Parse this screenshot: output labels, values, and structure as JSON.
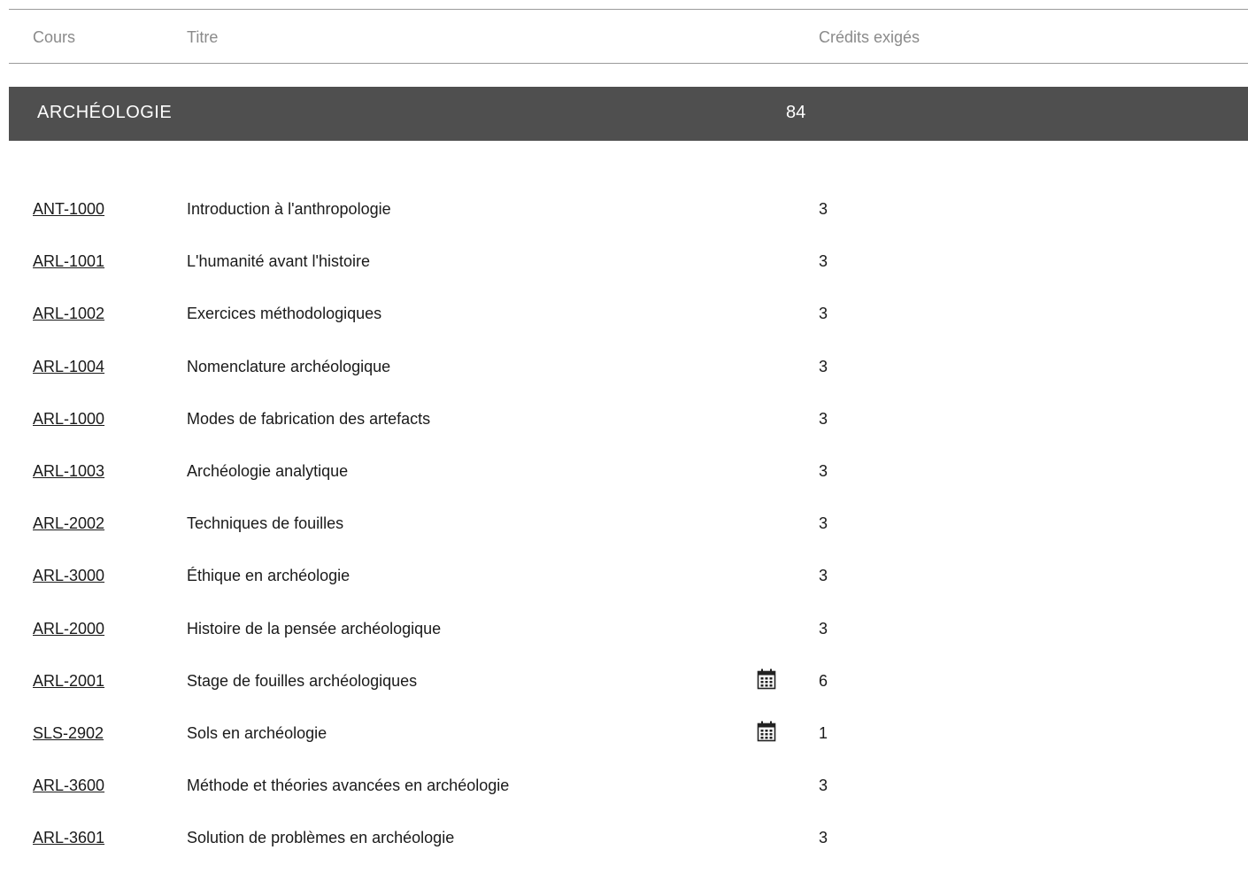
{
  "header": {
    "cours": "Cours",
    "titre": "Titre",
    "credits": "Crédits exigés"
  },
  "section": {
    "title": "ARCHÉOLOGIE",
    "credits": "84"
  },
  "courses": [
    {
      "code": "ANT-1000",
      "title": "Introduction à l'anthropologie",
      "credits": "3",
      "calendar": false
    },
    {
      "code": "ARL-1001",
      "title": "L'humanité avant l'histoire",
      "credits": "3",
      "calendar": false
    },
    {
      "code": "ARL-1002",
      "title": "Exercices méthodologiques",
      "credits": "3",
      "calendar": false
    },
    {
      "code": "ARL-1004",
      "title": "Nomenclature archéologique",
      "credits": "3",
      "calendar": false
    },
    {
      "code": "ARL-1000",
      "title": "Modes de fabrication des artefacts",
      "credits": "3",
      "calendar": false
    },
    {
      "code": "ARL-1003",
      "title": "Archéologie analytique",
      "credits": "3",
      "calendar": false
    },
    {
      "code": "ARL-2002",
      "title": "Techniques de fouilles",
      "credits": "3",
      "calendar": false
    },
    {
      "code": "ARL-3000",
      "title": "Éthique en archéologie",
      "credits": "3",
      "calendar": false
    },
    {
      "code": "ARL-2000",
      "title": "Histoire de la pensée archéologique",
      "credits": "3",
      "calendar": false
    },
    {
      "code": "ARL-2001",
      "title": "Stage de fouilles archéologiques",
      "credits": "6",
      "calendar": true
    },
    {
      "code": "SLS-2902",
      "title": "Sols en archéologie",
      "credits": "1",
      "calendar": true
    },
    {
      "code": "ARL-3600",
      "title": "Méthode et théories avancées en archéologie",
      "credits": "3",
      "calendar": false
    },
    {
      "code": "ARL-3601",
      "title": "Solution de problèmes en archéologie",
      "credits": "3",
      "calendar": false
    }
  ],
  "icons": {
    "calendar": "calendar-icon"
  },
  "colors": {
    "section_bar": "#4f4f4f",
    "header_text": "#8a8a8a",
    "row_text": "#1a1a1a"
  }
}
